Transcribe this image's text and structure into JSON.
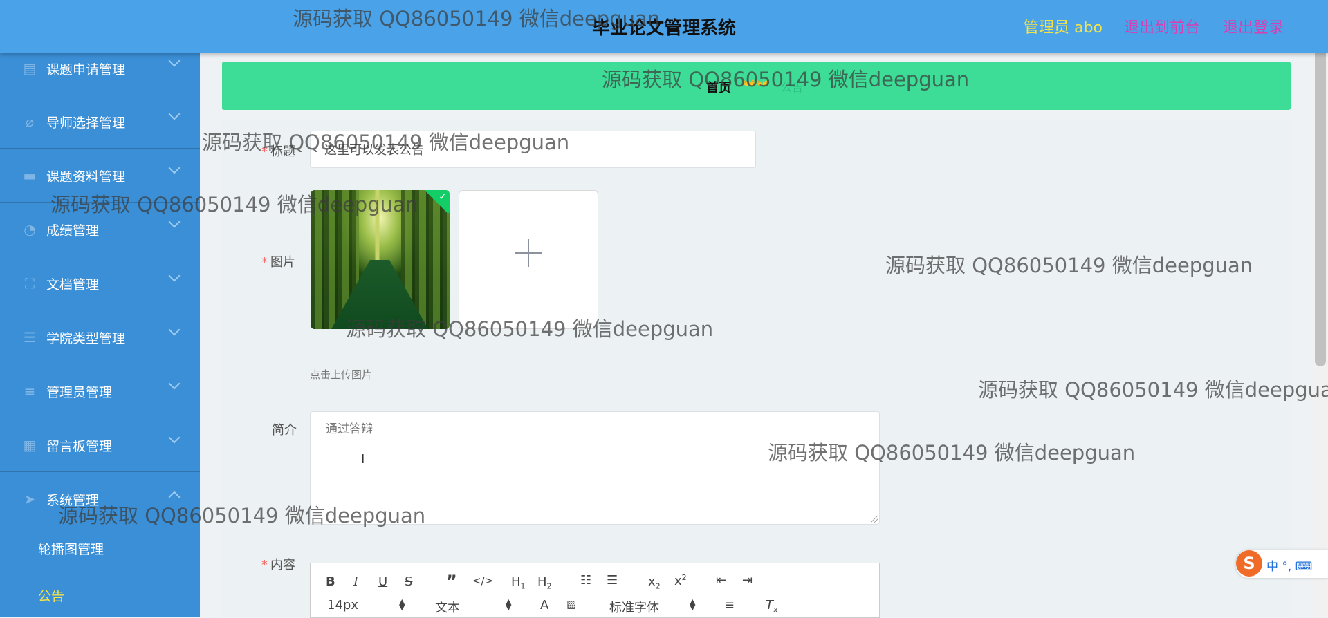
{
  "header": {
    "title": "毕业论文管理系统",
    "admin_label": "管理员 abo",
    "links": [
      "退出到前台",
      "退出登录"
    ]
  },
  "sidebar": {
    "items": [
      {
        "label": "课题申请管理",
        "icon": "document-icon"
      },
      {
        "label": "导师选择管理",
        "icon": "tutor-icon"
      },
      {
        "label": "课题资料管理",
        "icon": "chat-icon"
      },
      {
        "label": "成绩管理",
        "icon": "gauge-icon"
      },
      {
        "label": "文档管理",
        "icon": "frame-icon"
      },
      {
        "label": "学院类型管理",
        "icon": "list-icon"
      },
      {
        "label": "管理员管理",
        "icon": "sliders-icon"
      },
      {
        "label": "留言板管理",
        "icon": "grid-icon"
      },
      {
        "label": "系统管理",
        "icon": "send-icon"
      }
    ],
    "subitems": [
      {
        "label": "轮播图管理",
        "active": false
      },
      {
        "label": "公告",
        "active": true
      }
    ]
  },
  "breadcrumb": {
    "home": "首页",
    "emoji": "👐👐",
    "current": "公告"
  },
  "form": {
    "title_label": "标题",
    "title_value": "这里可以发表公告",
    "image_label": "图片",
    "upload_tip": "点击上传图片",
    "intro_label": "简介",
    "intro_value": "通过答辩",
    "content_label": "内容"
  },
  "editor": {
    "font_size": "14px",
    "text_style": "文本",
    "font_family": "标准字体"
  },
  "ime": {
    "logo": "S",
    "text": "中 °, ⌨"
  },
  "watermark": "源码获取 QQ86050149 微信deepguan",
  "colors": {
    "header_bg": "#4aa3e8",
    "sidebar_bg": "#3b8fd6",
    "breadcrumb_bg": "#3ddc97",
    "admin": "#f5e34a",
    "logout_links": "#d63fb4",
    "active_submenu": "#f5e34a"
  }
}
